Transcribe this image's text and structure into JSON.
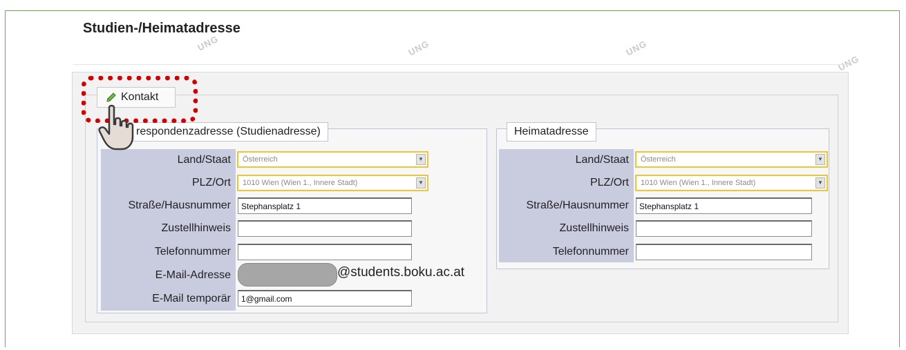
{
  "section": {
    "title": "Studien-/Heimatadresse",
    "watermark": "UNG",
    "edit_button_label": "Kontakt"
  },
  "study_address": {
    "legend": "respondenzadresse (Studienadresse)",
    "land_label": "Land/Staat",
    "land_value": "Österreich",
    "plz_label": "PLZ/Ort",
    "plz_value": "1010 Wien (Wien 1., Innere Stadt)",
    "street_label": "Straße/Hausnummer",
    "street_value": "Stephansplatz 1",
    "delivery_label": "Zustellhinweis",
    "delivery_value": "",
    "phone_label": "Telefonnummer",
    "phone_value": "",
    "email_label": "E-Mail-Adresse",
    "email_domain": "@students.boku.ac.at",
    "temp_email_label": "E-Mail temporär",
    "temp_email_value": "1@gmail.com"
  },
  "home_address": {
    "legend": "Heimatadresse",
    "land_label": "Land/Staat",
    "land_value": "Österreich",
    "plz_label": "PLZ/Ort",
    "plz_value": "1010 Wien (Wien 1., Innere Stadt)",
    "street_label": "Straße/Hausnummer",
    "street_value": "Stephansplatz 1",
    "delivery_label": "Zustellhinweis",
    "delivery_value": "",
    "phone_label": "Telefonnummer",
    "phone_value": ""
  },
  "icons": {
    "edit": "pencil-icon",
    "pointer": "hand-cursor-icon",
    "dropdown": "chevron-down-icon"
  },
  "colors": {
    "frame_border": "#5fb04b",
    "highlight": "#d40000",
    "select_border": "#f3c431",
    "label_column": "#c9cbdf"
  }
}
